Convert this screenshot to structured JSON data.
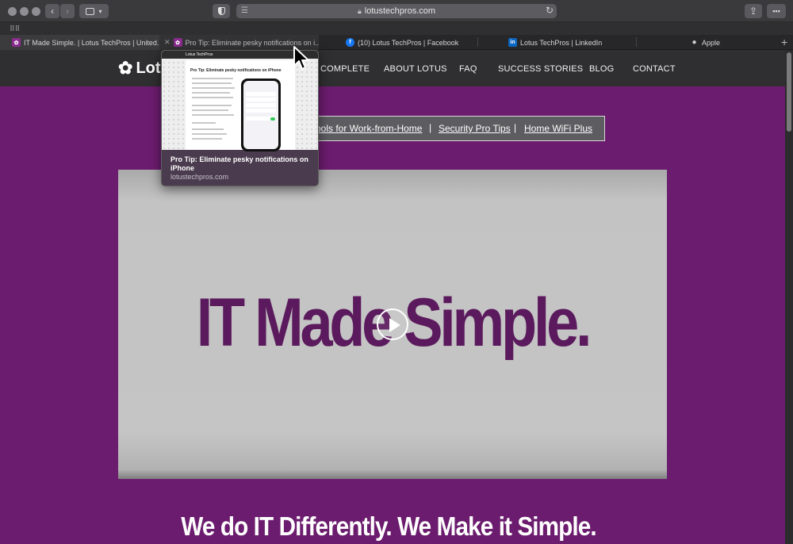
{
  "browser": {
    "address": "lotustechpros.com",
    "tabs": [
      {
        "label": "IT Made Simple. | Lotus TechPros | United...",
        "icon": "lotus-favicon"
      },
      {
        "label": "Pro Tip: Eliminate pesky notifications on i...",
        "icon": "lotus-favicon"
      },
      {
        "label": "(10) Lotus TechPros | Facebook",
        "icon": "facebook-favicon"
      },
      {
        "label": "Lotus TechPros | LinkedIn",
        "icon": "linkedin-favicon",
        "badge": "in"
      },
      {
        "label": "Apple",
        "icon": "apple-favicon"
      }
    ],
    "new_tab": "+"
  },
  "tab_preview": {
    "title": "Pro Tip: Eliminate pesky notifications on iPhone",
    "url": "lotustechpros.com",
    "thumb_heading": "Pro Tip: Eliminate pesky notifications on iPhone",
    "thumb_logo": "Lotus TechPros"
  },
  "site": {
    "logo": "Lotus",
    "nav": [
      "COMPLETE",
      "ABOUT LOTUS",
      "FAQ",
      "SUCCESS STORIES",
      "BLOG",
      "CONTACT"
    ],
    "sublinks": [
      "ools for Work-from-Home",
      "Security Pro Tips",
      "Home WiFi Plus"
    ],
    "separator": "|",
    "video_title": "IT Made Simple.",
    "tagline": "We do IT Differently. We Make it Simple."
  },
  "colors": {
    "brand_purple": "#6b1c6e",
    "title_purple": "#5b1a5d"
  }
}
